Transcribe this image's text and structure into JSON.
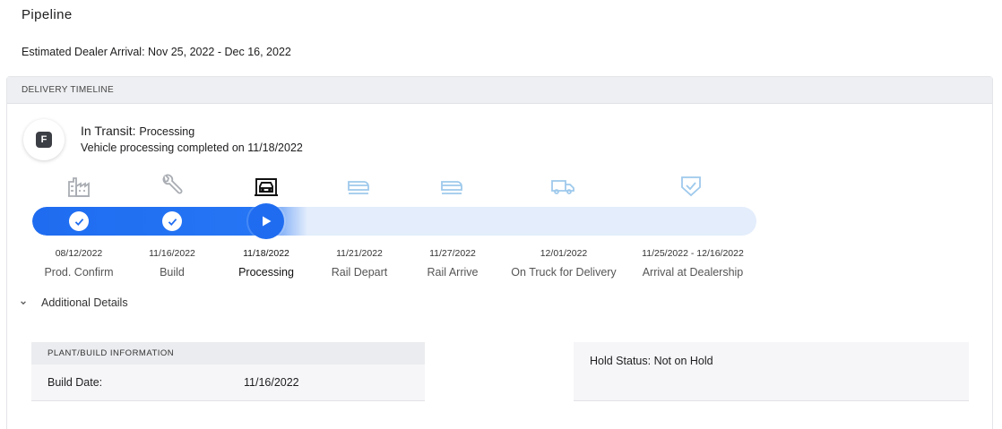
{
  "page": {
    "title": "Pipeline",
    "estimated_arrival": "Estimated Dealer Arrival: Nov 25, 2022 - Dec 16, 2022"
  },
  "card": {
    "header": "DELIVERY TIMELINE",
    "brand_badge": "F",
    "status_label": "In Transit:",
    "status_value": "Processing",
    "status_description": "Vehicle processing completed on 11/18/2022"
  },
  "timeline": {
    "progress_percent": 38,
    "accent_color": "#1f6cf0",
    "stages": [
      {
        "icon": "factory-icon",
        "date": "08/12/2022",
        "label": "Prod. Confirm",
        "state": "complete"
      },
      {
        "icon": "wrench-icon",
        "date": "11/16/2022",
        "label": "Build",
        "state": "complete"
      },
      {
        "icon": "vehicle-processing-icon",
        "date": "11/18/2022",
        "label": "Processing",
        "state": "current"
      },
      {
        "icon": "rail-depart-icon",
        "date": "11/21/2022",
        "label": "Rail Depart",
        "state": "upcoming"
      },
      {
        "icon": "rail-arrive-icon",
        "date": "11/27/2022",
        "label": "Rail Arrive",
        "state": "upcoming"
      },
      {
        "icon": "truck-icon",
        "date": "12/01/2022",
        "label": "On Truck for Delivery",
        "state": "upcoming"
      },
      {
        "icon": "shield-check-icon",
        "date": "11/25/2022 - 12/16/2022",
        "label": "Arrival at Dealership",
        "state": "upcoming"
      }
    ]
  },
  "details": {
    "toggle_label": "Additional Details",
    "plant_panel": {
      "header": "PLANT/BUILD INFORMATION",
      "build_date_label": "Build Date:",
      "build_date_value": "11/16/2022"
    },
    "hold_status": "Hold Status: Not on Hold"
  }
}
